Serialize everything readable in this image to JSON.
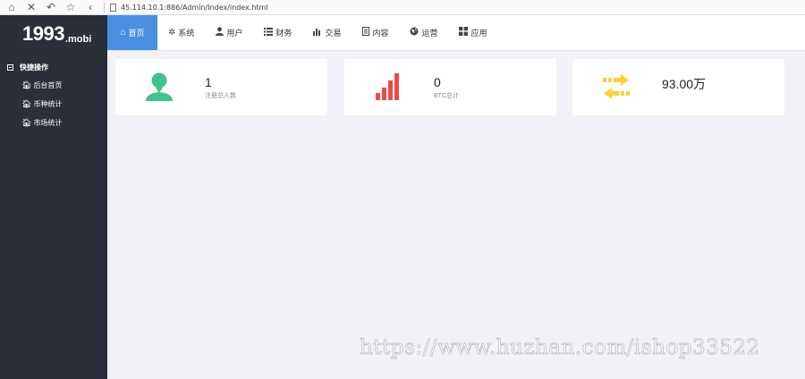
{
  "browser": {
    "url": "45.114.10.1:886/Admin/Index/index.html"
  },
  "logo": {
    "main": "1993",
    "suffix": ".mobi"
  },
  "sidebar": {
    "section_label": "快捷操作",
    "items": [
      {
        "label": "后台首页",
        "icon": "home-icon"
      },
      {
        "label": "币种统计",
        "icon": "home-icon"
      },
      {
        "label": "市场统计",
        "icon": "home-icon"
      }
    ]
  },
  "nav": {
    "items": [
      {
        "label": "首页",
        "icon": "home-icon"
      },
      {
        "label": "系统",
        "icon": "gear-icon"
      },
      {
        "label": "用户",
        "icon": "user-icon"
      },
      {
        "label": "财务",
        "icon": "list-icon"
      },
      {
        "label": "交易",
        "icon": "bar-chart-icon"
      },
      {
        "label": "内容",
        "icon": "document-icon"
      },
      {
        "label": "运营",
        "icon": "globe-icon"
      },
      {
        "label": "应用",
        "icon": "grid-icon"
      }
    ],
    "active_index": 0
  },
  "stats": [
    {
      "value": "1",
      "label": "注册总人数",
      "icon": "user-icon",
      "color": "#3dc48a"
    },
    {
      "value": "0",
      "label": "BTC总计",
      "icon": "signal-bars-icon",
      "color": "#f04848"
    },
    {
      "value": "93.00万",
      "label": "",
      "icon": "exchange-arrows-icon",
      "color": "#fbd233"
    }
  ],
  "colors": {
    "sidebar_bg": "#2a2f3a",
    "nav_active": "#4a90e2",
    "page_bg": "#f1f2f7"
  },
  "watermark": "https://www.huzhan.com/ishop33522"
}
